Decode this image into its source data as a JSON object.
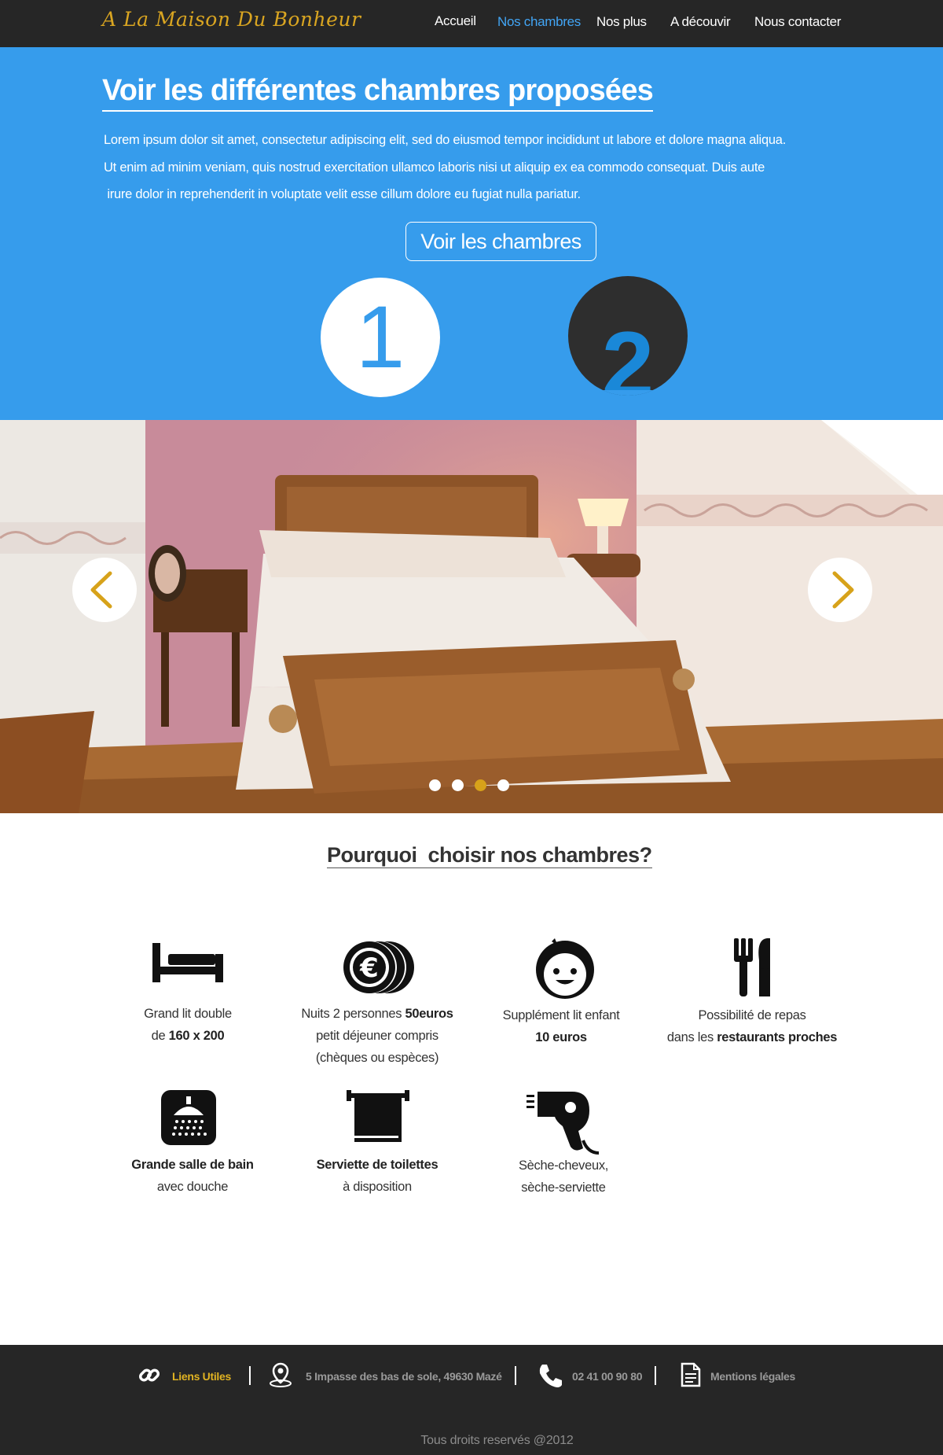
{
  "site": {
    "logo": "A La Maison Du Bonheur"
  },
  "nav": {
    "items": [
      {
        "label": "Accueil",
        "active": false
      },
      {
        "label": "Nos chambres",
        "active": true
      },
      {
        "label": "Nos plus",
        "active": false
      },
      {
        "label": "A découvir",
        "active": false
      },
      {
        "label": "Nous contacter",
        "active": false
      }
    ]
  },
  "hero": {
    "title": "Voir les différentes chambres proposées",
    "paragraph_lines": [
      "Lorem ipsum dolor sit amet, consectetur adipiscing elit, sed do eiusmod tempor incididunt ut labore et dolore magna aliqua.",
      "Ut enim ad minim veniam, quis nostrud exercitation ullamco laboris nisi ut aliquip ex ea commodo consequat. Duis aute",
      " irure dolor in reprehenderit in voluptate velit esse cillum dolore eu fugiat nulla pariatur."
    ],
    "button_label": "Voir les chambres",
    "room_numbers": [
      "1",
      "2"
    ]
  },
  "slider": {
    "image_icon": "bedroom-photo",
    "prev_icon": "chevron-left-icon",
    "next_icon": "chevron-right-icon",
    "slide_count": 4,
    "active_slide": 3
  },
  "features": {
    "title": "Pourquoi  choisir nos chambres?",
    "items": [
      {
        "icon": "bed-icon",
        "lines": [
          [
            "Grand lit double"
          ],
          [
            "de ",
            {
              "b": "160 x 200"
            }
          ]
        ]
      },
      {
        "icon": "euro-coins-icon",
        "lines": [
          [
            "Nuits 2 personnes ",
            {
              "b": "50euros"
            }
          ],
          [
            "petit déjeuner compris"
          ],
          [
            "(chèques ou espèces)"
          ]
        ]
      },
      {
        "icon": "child-face-icon",
        "lines": [
          [
            "Supplément lit enfant"
          ],
          [
            {
              "b": "10 euros"
            }
          ]
        ]
      },
      {
        "icon": "fork-knife-icon",
        "lines": [
          [
            "Possibilité de repas"
          ],
          [
            "dans les ",
            {
              "b": "restaurants proches"
            }
          ]
        ]
      },
      {
        "icon": "shower-icon",
        "lines": [
          [
            {
              "b": "Grande salle de bain"
            }
          ],
          [
            "avec douche"
          ]
        ]
      },
      {
        "icon": "towel-icon",
        "lines": [
          [
            {
              "b": "Serviette de toilettes"
            }
          ],
          [
            "à disposition"
          ]
        ]
      },
      {
        "icon": "hair-dryer-icon",
        "lines": [
          [
            "Sèche-cheveux,"
          ],
          [
            "sèche-serviette"
          ]
        ]
      }
    ]
  },
  "footer": {
    "links_label": "Liens Utiles",
    "address": "5 Impasse des bas de sole, 49630 Mazé",
    "phone": "02 41 00 90 80",
    "legal": "Mentions légales",
    "copyright": "Tous droits reservés @2012",
    "colors": {
      "background": "#262626",
      "accent": "#e1b322"
    }
  },
  "colors": {
    "hero_blue": "#369cec",
    "nav_active": "#42a5f5",
    "logo_gold": "#d9a521",
    "dot_active": "#d7a21a"
  }
}
